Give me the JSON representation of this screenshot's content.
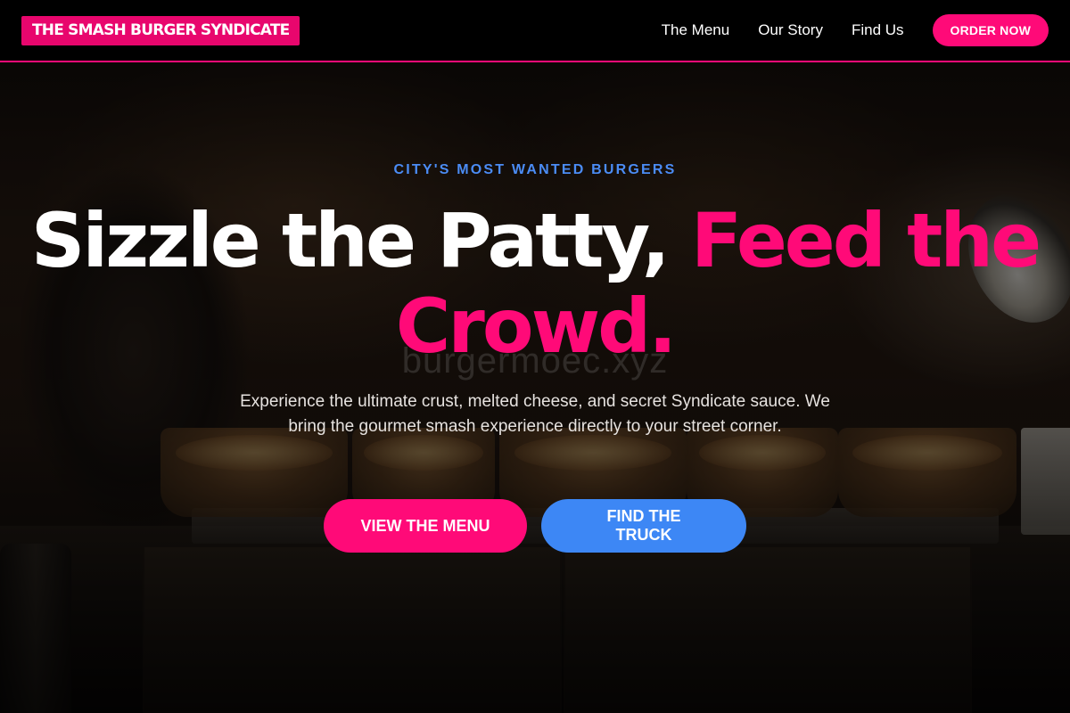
{
  "header": {
    "logo": "THE SMASH BURGER SYNDICATE",
    "nav": [
      {
        "label": "The Menu"
      },
      {
        "label": "Our Story"
      },
      {
        "label": "Find Us"
      }
    ],
    "order_label": "ORDER NOW"
  },
  "hero": {
    "eyebrow": "CITY'S MOST WANTED BURGERS",
    "headline_white": "Sizzle the Patty, ",
    "headline_accent": "Feed the Crowd.",
    "watermark": "burgermoec.xyz",
    "subtext": "Experience the ultimate crust, melted cheese, and secret Syndicate sauce. We bring the gourmet smash experience directly to your street corner.",
    "primary_cta": "VIEW THE MENU",
    "secondary_cta": "FIND THE TRUCK"
  },
  "colors": {
    "accent_pink": "#ff0a78",
    "accent_blue": "#3d87f5",
    "header_bg": "#000000"
  }
}
